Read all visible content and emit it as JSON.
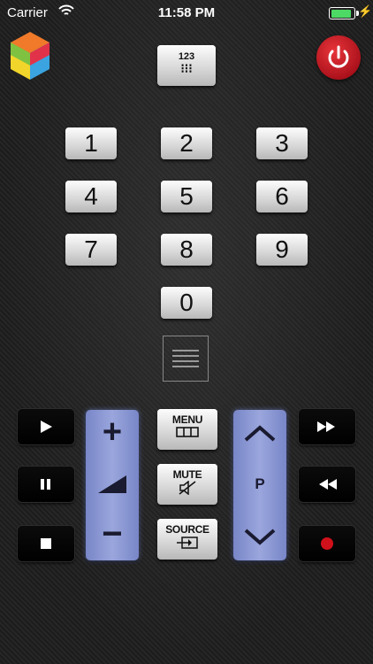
{
  "status_bar": {
    "carrier": "Carrier",
    "time": "11:58 PM",
    "battery_color": "#4cd964",
    "icons": [
      "wifi-icon",
      "battery-icon",
      "charging-bolt-icon"
    ]
  },
  "top": {
    "btn_123_label": "123",
    "btn_123_sub": "⁝⁝⁝",
    "logo_icon": "cube-logo-icon",
    "power_icon": "power-icon",
    "power_color": "#c8141e"
  },
  "keypad": {
    "d1": "1",
    "d2": "2",
    "d3": "3",
    "d4": "4",
    "d5": "5",
    "d6": "6",
    "d7": "7",
    "d8": "8",
    "d9": "9",
    "d0": "0"
  },
  "menu_icon": "hamburger-menu-icon",
  "controls": {
    "play_icon": "play-icon",
    "pause_icon": "pause-icon",
    "stop_icon": "stop-icon",
    "fast_forward_icon": "fast-forward-icon",
    "rewind_icon": "rewind-icon",
    "record_icon": "record-icon",
    "volume_plus": "+",
    "volume_minus": "−",
    "channel_label": "P",
    "menu_label": "MENU",
    "mute_label": "MUTE",
    "source_label": "SOURCE",
    "rocker_color": "#8d99d6"
  }
}
